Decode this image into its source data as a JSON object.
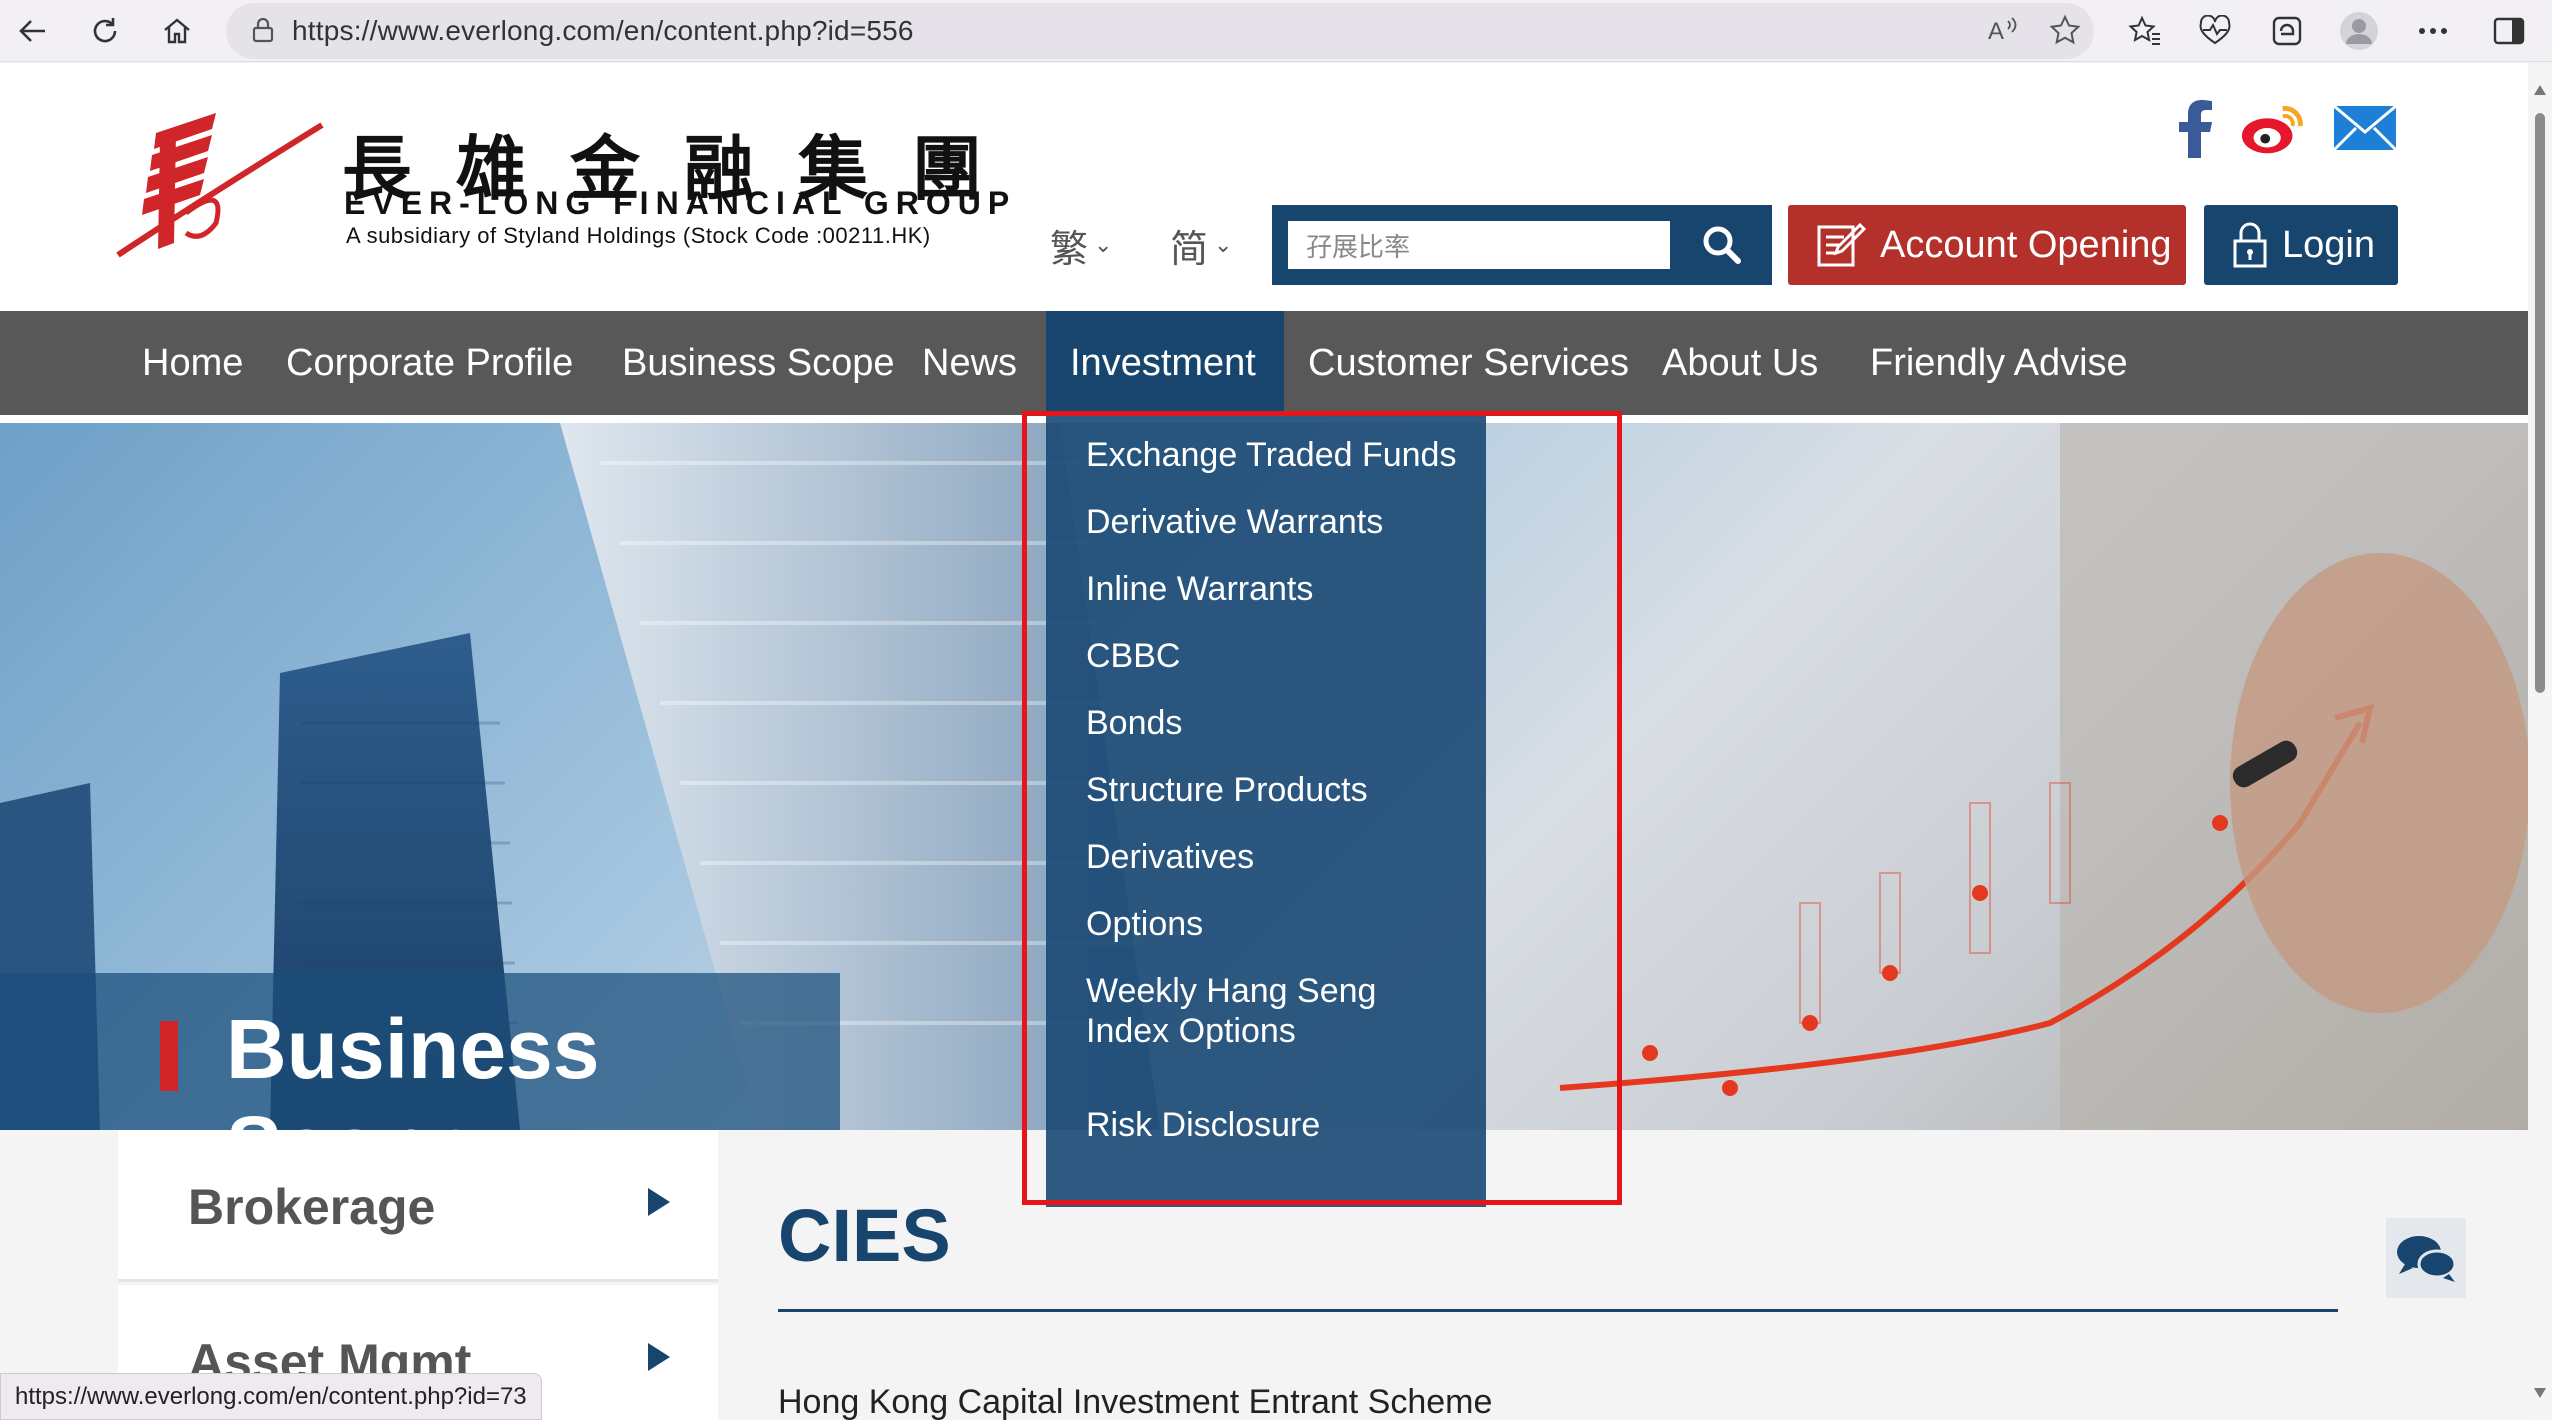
{
  "browser": {
    "url": "https://www.everlong.com/en/content.php?id=556",
    "status_url": "https://www.everlong.com/en/content.php?id=73"
  },
  "header": {
    "logo_cn": "長雄金融集團",
    "logo_en": "EVER-LONG FINANCIAL GROUP",
    "logo_sub": "A subsidiary of Styland Holdings (Stock Code :00211.HK)",
    "lang_traditional": "繁",
    "lang_simplified": "简",
    "search_placeholder": "孖展比率",
    "account_opening": "Account Opening",
    "login": "Login"
  },
  "nav": {
    "items": [
      "Home",
      "Corporate Profile",
      "Business Scope",
      "News",
      "Investment",
      "Customer Services",
      "About Us",
      "Friendly Advise"
    ],
    "active": "Investment"
  },
  "dropdown": {
    "items": [
      "Exchange Traded Funds",
      "Derivative Warrants",
      "Inline Warrants",
      "CBBC",
      "Bonds",
      "Structure Products",
      "Derivatives",
      "Options",
      "Weekly Hang Seng Index Options",
      "Risk Disclosure"
    ]
  },
  "hero": {
    "title": "Business Scope"
  },
  "sidebar": {
    "items": [
      "Brokerage",
      "Asset Mgmt"
    ]
  },
  "content": {
    "title": "CIES",
    "subtitle": "Hong Kong Capital Investment Entrant Scheme"
  },
  "colors": {
    "brand_blue": "#17456e",
    "brand_red": "#b3302b",
    "nav_gray": "#585858"
  }
}
